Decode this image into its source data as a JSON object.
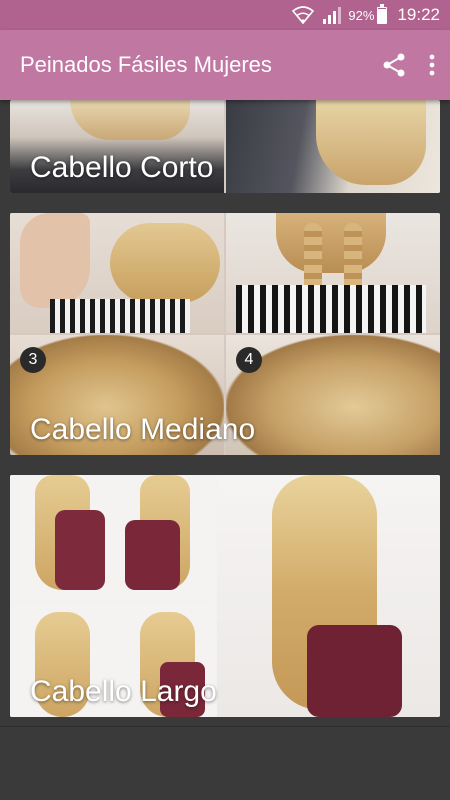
{
  "status_bar": {
    "battery_percent": "92%",
    "battery_level": 0.92,
    "time": "19:22",
    "icons": [
      "wifi-icon",
      "signal-icon",
      "battery-icon"
    ]
  },
  "app_bar": {
    "title": "Peinados Fásiles Mujeres",
    "background": "#c077a2",
    "actions": [
      "share-icon",
      "more-vertical-icon"
    ]
  },
  "categories": [
    {
      "label": "Cabello Corto"
    },
    {
      "label": "Cabello Mediano",
      "steps": [
        "3",
        "4"
      ]
    },
    {
      "label": "Cabello Largo"
    }
  ]
}
